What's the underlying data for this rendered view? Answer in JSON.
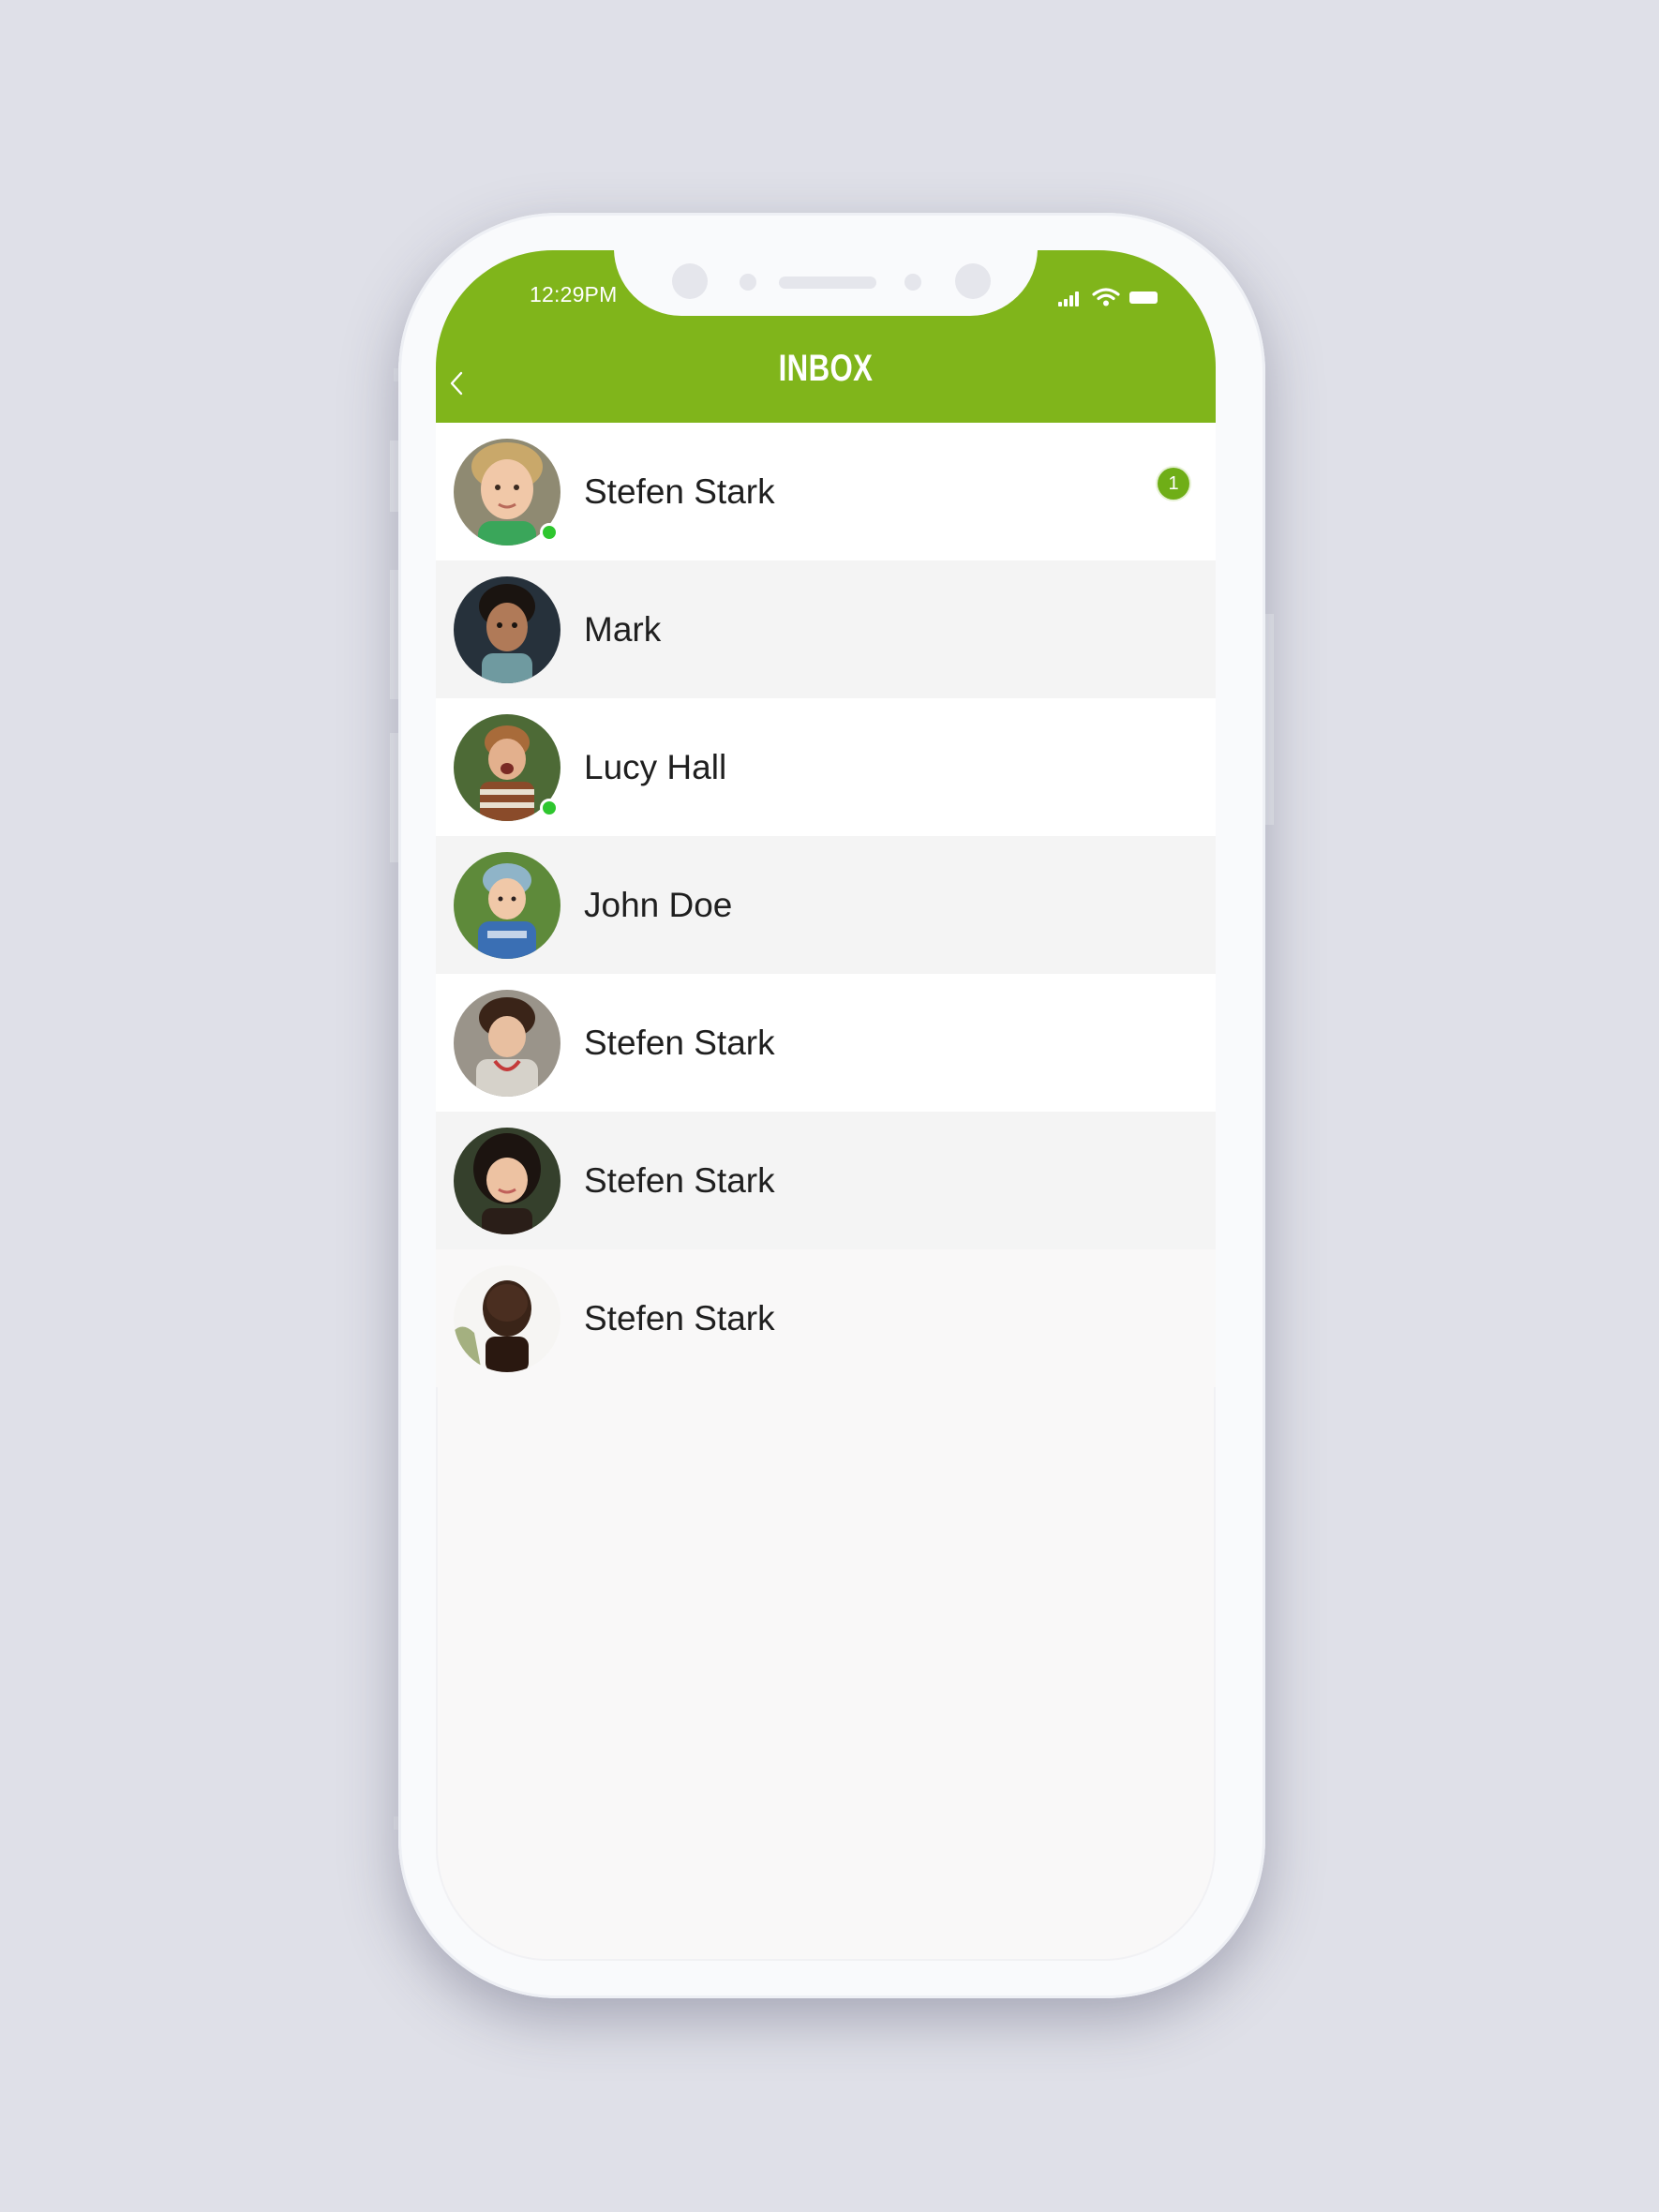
{
  "status_bar": {
    "time": "12:29PM"
  },
  "header": {
    "title": "INBOX",
    "back_icon": "chevron-left-icon"
  },
  "colors": {
    "accent": "#80b51b",
    "online": "#2ec62e",
    "badge": "#6fae17"
  },
  "contacts": [
    {
      "name": "Stefen Stark",
      "online": true,
      "unread": "1"
    },
    {
      "name": "Mark",
      "online": false,
      "unread": ""
    },
    {
      "name": "Lucy Hall",
      "online": true,
      "unread": ""
    },
    {
      "name": "John Doe",
      "online": false,
      "unread": ""
    },
    {
      "name": "Stefen Stark",
      "online": false,
      "unread": ""
    },
    {
      "name": "Stefen Stark",
      "online": false,
      "unread": ""
    },
    {
      "name": "Stefen Stark",
      "online": false,
      "unread": ""
    }
  ]
}
